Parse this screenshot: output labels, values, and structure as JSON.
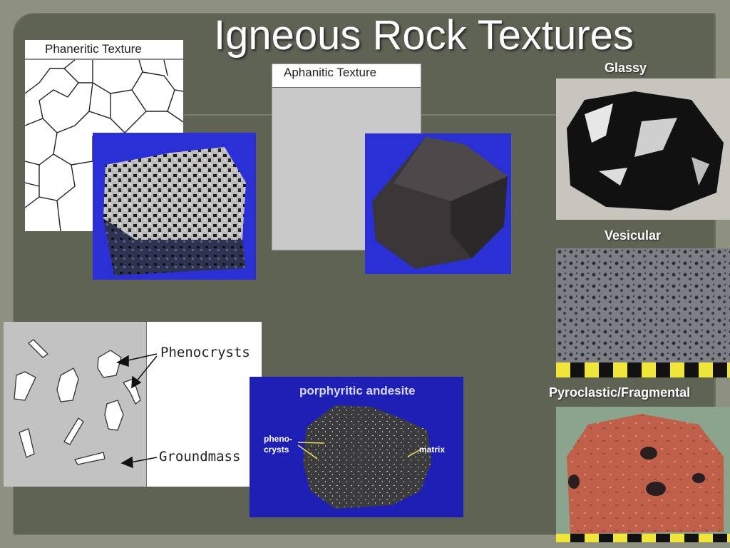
{
  "slide": {
    "title": "Igneous Rock Textures"
  },
  "phaneritic": {
    "label": "Phaneritic Texture"
  },
  "aphanitic": {
    "label": "Aphanitic Texture"
  },
  "porphyritic_diagram": {
    "phenocrysts_label": "Phenocrysts",
    "groundmass_label": "Groundmass"
  },
  "porphyritic_photo": {
    "title": "porphyritic andesite",
    "pheno_label_line1": "pheno-",
    "pheno_label_line2": "crysts",
    "matrix_label": "matrix"
  },
  "sidebar": {
    "glassy": "Glassy",
    "vesicular": "Vesicular",
    "pyroclastic": "Pyroclastic/Fragmental"
  },
  "colors": {
    "background": "#5f6354",
    "photo_backdrop_blue": "#2b2fd6",
    "title_text": "#ffffff"
  }
}
